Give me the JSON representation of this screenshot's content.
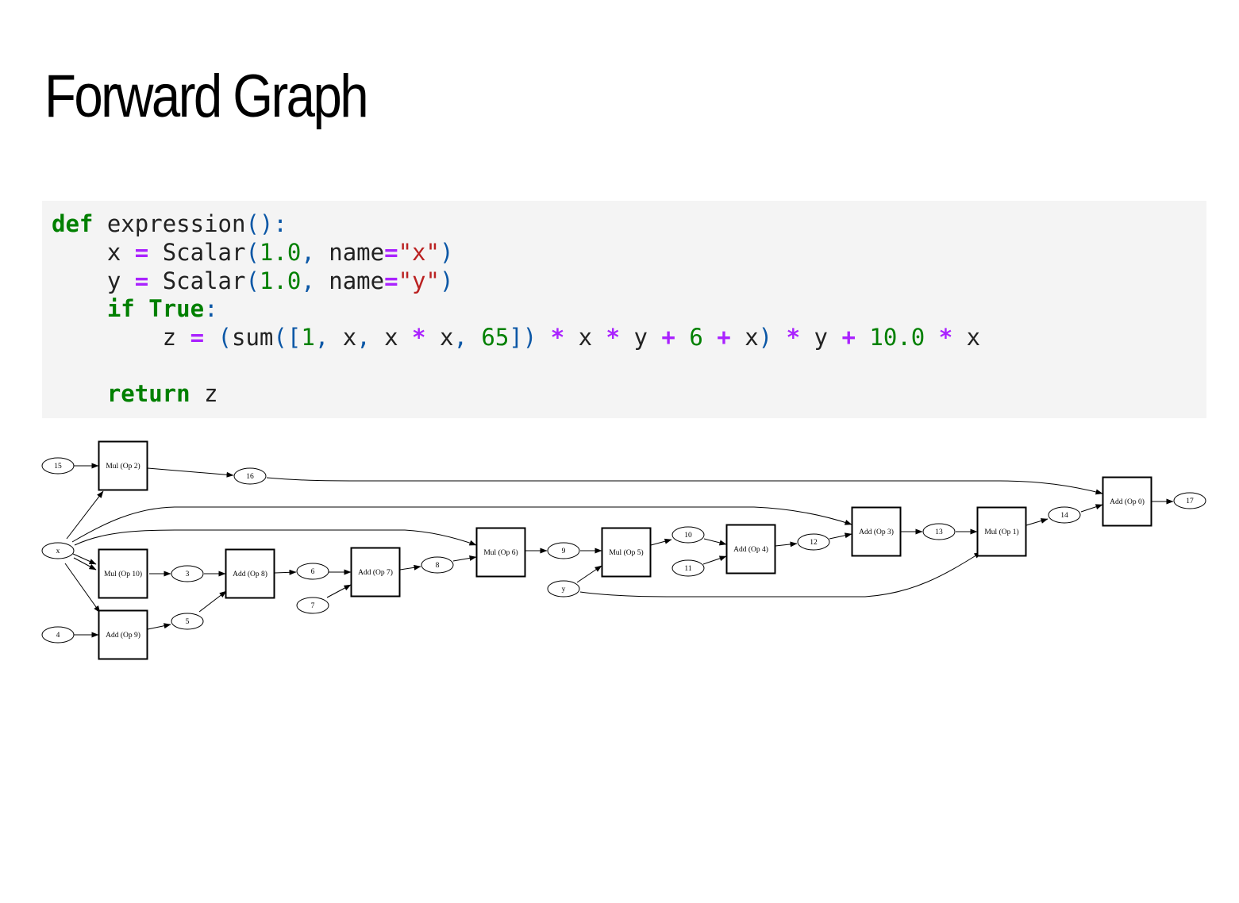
{
  "title": "Forward Graph",
  "code": [
    [
      {
        "t": "def",
        "c": "kw"
      },
      {
        "t": " expression"
      },
      {
        "t": "():",
        "c": "pun"
      }
    ],
    [
      {
        "t": "    x "
      },
      {
        "t": "=",
        "c": "op"
      },
      {
        "t": " Scalar"
      },
      {
        "t": "(",
        "c": "pun"
      },
      {
        "t": "1.0",
        "c": "num"
      },
      {
        "t": ",",
        "c": "pun"
      },
      {
        "t": " name"
      },
      {
        "t": "=",
        "c": "op"
      },
      {
        "t": "\"x\"",
        "c": "str"
      },
      {
        "t": ")",
        "c": "pun"
      }
    ],
    [
      {
        "t": "    y "
      },
      {
        "t": "=",
        "c": "op"
      },
      {
        "t": " Scalar"
      },
      {
        "t": "(",
        "c": "pun"
      },
      {
        "t": "1.0",
        "c": "num"
      },
      {
        "t": ",",
        "c": "pun"
      },
      {
        "t": " name"
      },
      {
        "t": "=",
        "c": "op"
      },
      {
        "t": "\"y\"",
        "c": "str"
      },
      {
        "t": ")",
        "c": "pun"
      }
    ],
    [
      {
        "t": "    "
      },
      {
        "t": "if",
        "c": "kw"
      },
      {
        "t": " "
      },
      {
        "t": "True",
        "c": "kw"
      },
      {
        "t": ":",
        "c": "pun"
      }
    ],
    [
      {
        "t": "        z "
      },
      {
        "t": "=",
        "c": "op"
      },
      {
        "t": " "
      },
      {
        "t": "(",
        "c": "pun"
      },
      {
        "t": "sum"
      },
      {
        "t": "([",
        "c": "pun"
      },
      {
        "t": "1",
        "c": "num"
      },
      {
        "t": ",",
        "c": "pun"
      },
      {
        "t": " x"
      },
      {
        "t": ",",
        "c": "pun"
      },
      {
        "t": " x "
      },
      {
        "t": "*",
        "c": "op"
      },
      {
        "t": " x"
      },
      {
        "t": ",",
        "c": "pun"
      },
      {
        "t": " "
      },
      {
        "t": "65",
        "c": "num"
      },
      {
        "t": "])",
        "c": "pun"
      },
      {
        "t": " "
      },
      {
        "t": "*",
        "c": "op"
      },
      {
        "t": " x "
      },
      {
        "t": "*",
        "c": "op"
      },
      {
        "t": " y "
      },
      {
        "t": "+",
        "c": "op"
      },
      {
        "t": " "
      },
      {
        "t": "6",
        "c": "num"
      },
      {
        "t": " "
      },
      {
        "t": "+",
        "c": "op"
      },
      {
        "t": " x"
      },
      {
        "t": ")",
        "c": "pun"
      },
      {
        "t": " "
      },
      {
        "t": "*",
        "c": "op"
      },
      {
        "t": " y "
      },
      {
        "t": "+",
        "c": "op"
      },
      {
        "t": " "
      },
      {
        "t": "10.0",
        "c": "num"
      },
      {
        "t": " "
      },
      {
        "t": "*",
        "c": "op"
      },
      {
        "t": " x"
      }
    ],
    [
      {
        "t": ""
      }
    ],
    [
      {
        "t": "    "
      },
      {
        "t": "return",
        "c": "kw"
      },
      {
        "t": " z"
      }
    ]
  ],
  "graph": {
    "values": [
      "15",
      "16",
      "17",
      "x",
      "3",
      "4",
      "5",
      "6",
      "7",
      "8",
      "9",
      "y",
      "10",
      "11",
      "12",
      "13",
      "14"
    ],
    "ops": [
      "Mul (Op 2)",
      "Mul (Op 10)",
      "Add (Op 9)",
      "Add (Op 8)",
      "Add (Op 7)",
      "Mul (Op 6)",
      "Mul (Op 5)",
      "Add (Op 4)",
      "Add (Op 3)",
      "Mul (Op 1)",
      "Add (Op 0)"
    ],
    "edges": [
      [
        "15",
        "Mul (Op 2)"
      ],
      [
        "x",
        "Mul (Op 2)"
      ],
      [
        "Mul (Op 2)",
        "16"
      ],
      [
        "16",
        "Add (Op 0)"
      ],
      [
        "x",
        "Mul (Op 10)"
      ],
      [
        "x",
        "Mul (Op 10)"
      ],
      [
        "Mul (Op 10)",
        "3"
      ],
      [
        "x",
        "Add (Op 9)"
      ],
      [
        "4",
        "Add (Op 9)"
      ],
      [
        "Add (Op 9)",
        "5"
      ],
      [
        "3",
        "Add (Op 8)"
      ],
      [
        "5",
        "Add (Op 8)"
      ],
      [
        "Add (Op 8)",
        "6"
      ],
      [
        "6",
        "Add (Op 7)"
      ],
      [
        "7",
        "Add (Op 7)"
      ],
      [
        "Add (Op 7)",
        "8"
      ],
      [
        "8",
        "Mul (Op 6)"
      ],
      [
        "x",
        "Mul (Op 6)"
      ],
      [
        "Mul (Op 6)",
        "9"
      ],
      [
        "9",
        "Mul (Op 5)"
      ],
      [
        "y",
        "Mul (Op 5)"
      ],
      [
        "Mul (Op 5)",
        "10"
      ],
      [
        "10",
        "Add (Op 4)"
      ],
      [
        "11",
        "Add (Op 4)"
      ],
      [
        "Add (Op 4)",
        "12"
      ],
      [
        "12",
        "Add (Op 3)"
      ],
      [
        "x",
        "Add (Op 3)"
      ],
      [
        "Add (Op 3)",
        "13"
      ],
      [
        "13",
        "Mul (Op 1)"
      ],
      [
        "y",
        "Mul (Op 1)"
      ],
      [
        "Mul (Op 1)",
        "14"
      ],
      [
        "14",
        "Add (Op 0)"
      ],
      [
        "Add (Op 0)",
        "17"
      ]
    ]
  }
}
